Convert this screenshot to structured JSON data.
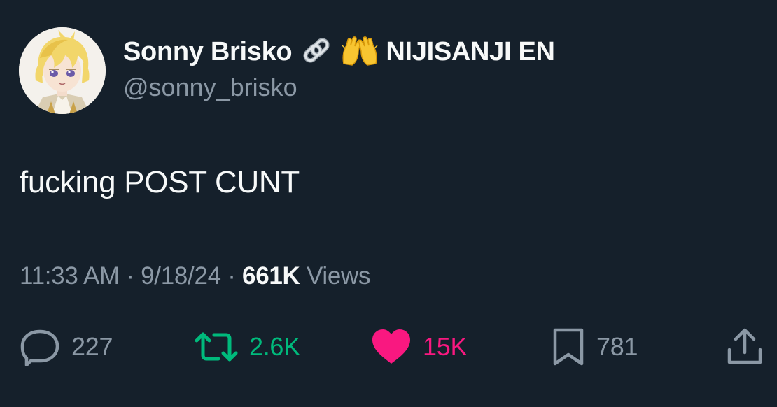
{
  "author": {
    "display_name": "Sonny Brisko",
    "affiliation_icons": [
      "link-icon",
      "raising-hands-icon"
    ],
    "affiliation": "NIJISANJI EN",
    "handle": "@sonny_brisko"
  },
  "tweet": {
    "text": "fucking POST CUNT"
  },
  "meta": {
    "time": "11:33 AM",
    "separator_1": "·",
    "date": "9/18/24",
    "separator_2": "·",
    "views_count": "661K",
    "views_label": "Views"
  },
  "actions": {
    "reply": {
      "icon": "reply-bubble-icon",
      "count": "227",
      "color": "#8b98a5"
    },
    "retweet": {
      "icon": "retweet-icon",
      "count": "2.6K",
      "color": "#00ba7c"
    },
    "like": {
      "icon": "heart-icon",
      "count": "15K",
      "color": "#f91880"
    },
    "bookmark": {
      "icon": "bookmark-icon",
      "count": "781",
      "color": "#8b98a5"
    },
    "share": {
      "icon": "share-icon",
      "color": "#8b98a5"
    }
  },
  "colors": {
    "background": "#15202b",
    "primary_text": "#f7f9f9",
    "secondary_text": "#8b98a5"
  }
}
